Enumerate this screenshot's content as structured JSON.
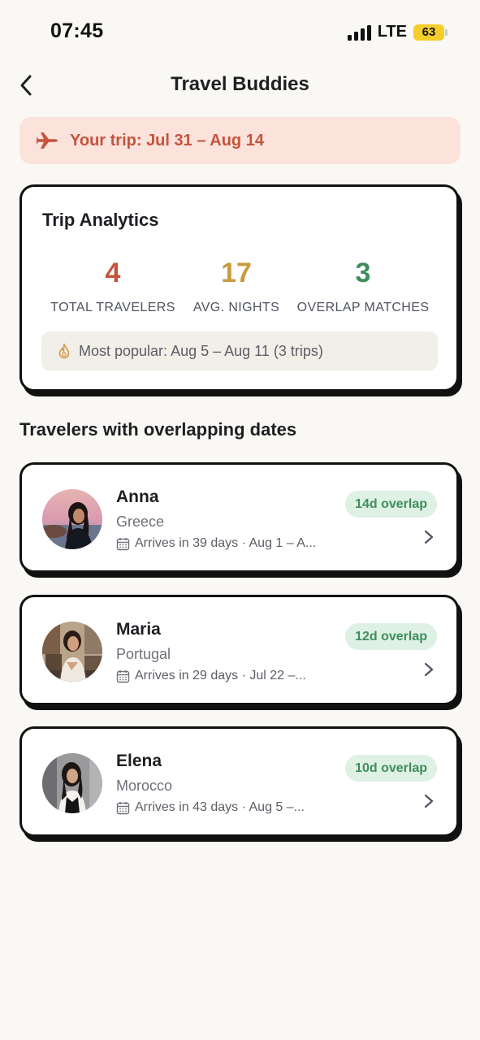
{
  "status_bar": {
    "time": "07:45",
    "network": "LTE",
    "battery": "63",
    "battery_color": "#f5cd2a"
  },
  "header": {
    "title": "Travel Buddies",
    "back_icon": "chevron-left-icon"
  },
  "trip_banner": {
    "icon": "airplane-icon",
    "text": "Your trip: Jul 31 – Aug 14",
    "color": "#c6533c",
    "background": "#fbe3dc"
  },
  "analytics": {
    "title": "Trip Analytics",
    "stats": [
      {
        "value": "4",
        "label": "TOTAL TRAVELERS",
        "color": "#c6533c"
      },
      {
        "value": "17",
        "label": "AVG. NIGHTS",
        "color": "#c99a3e"
      },
      {
        "value": "3",
        "label": "OVERLAP MATCHES",
        "color": "#3e8e5c"
      }
    ],
    "popular_icon": "flame-icon",
    "popular_text": "Most popular: Aug 5 – Aug 11 (3 trips)"
  },
  "section_heading": "Travelers with overlapping dates",
  "travelers": [
    {
      "name": "Anna",
      "country": "Greece",
      "arrival": "Arrives in 39 days · Aug 1 – A...",
      "overlap": "14d overlap"
    },
    {
      "name": "Maria",
      "country": "Portugal",
      "arrival": "Arrives in 29 days · Jul 22 –...",
      "overlap": "12d overlap"
    },
    {
      "name": "Elena",
      "country": "Morocco",
      "arrival": "Arrives in 43 days · Aug 5 –...",
      "overlap": "10d overlap"
    }
  ]
}
